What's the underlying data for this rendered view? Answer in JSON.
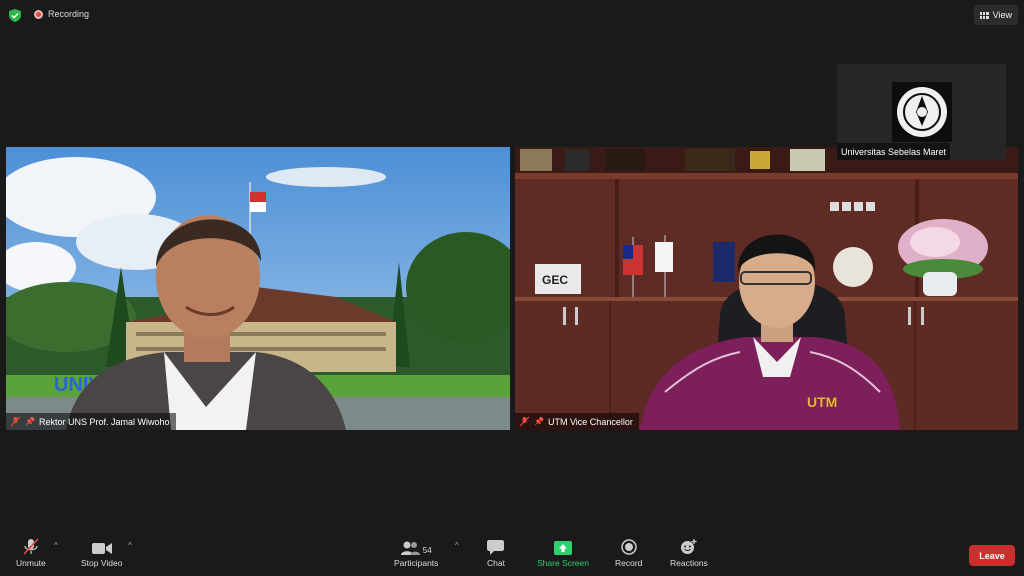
{
  "topbar": {
    "recording_label": "Recording",
    "view_label": "View"
  },
  "participants": {
    "left_name": "Rektor UNS Prof. Jamal Wiwoho",
    "right_name": "UTM Vice Chancellor",
    "thumbnail_name": "Universitas Sebelas Maret"
  },
  "backdrop_sign": "UNIV  RSITAS MARET",
  "toolbar": {
    "unmute": "Unmute",
    "stop_video": "Stop Video",
    "participants": "Participants",
    "participants_count": "54",
    "chat": "Chat",
    "share_screen": "Share Screen",
    "record": "Record",
    "reactions": "Reactions",
    "leave": "Leave"
  },
  "colors": {
    "background": "#1a1a1a",
    "leave_button": "#c9302c",
    "share_screen_green": "#2fcf6e",
    "recording_red": "#e04a3f",
    "shield_green": "#2db84d"
  }
}
